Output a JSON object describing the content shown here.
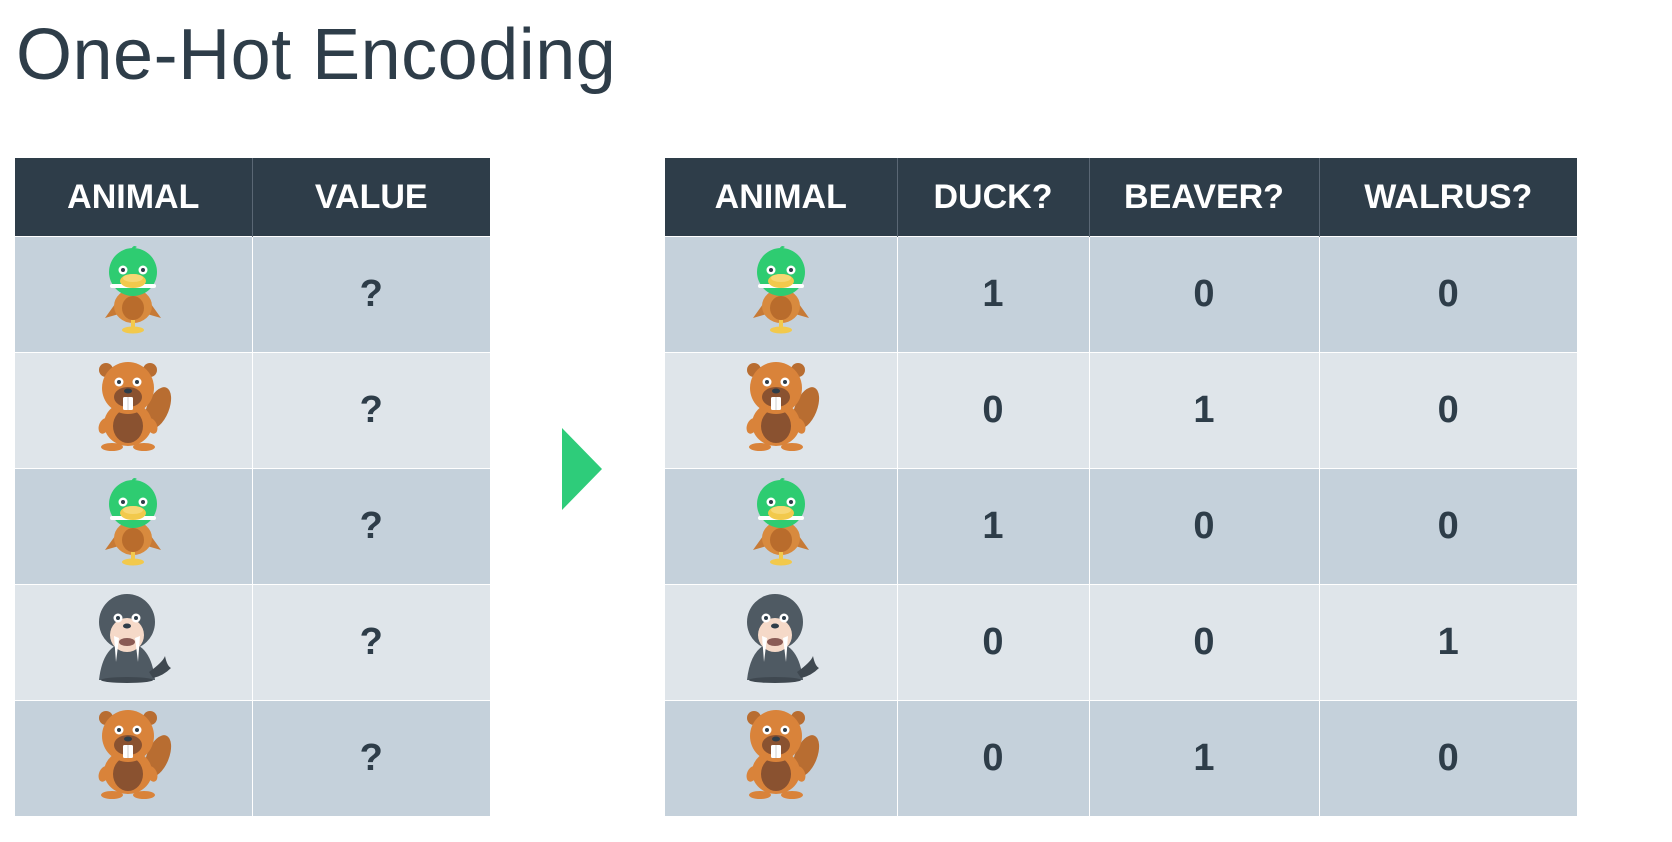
{
  "title": "One-Hot Encoding",
  "left_table": {
    "headers": [
      "ANIMAL",
      "VALUE"
    ],
    "rows": [
      {
        "animal": "duck",
        "value": "?"
      },
      {
        "animal": "beaver",
        "value": "?"
      },
      {
        "animal": "duck",
        "value": "?"
      },
      {
        "animal": "walrus",
        "value": "?"
      },
      {
        "animal": "beaver",
        "value": "?"
      }
    ]
  },
  "right_table": {
    "headers": [
      "ANIMAL",
      "DUCK?",
      "BEAVER?",
      "WALRUS?"
    ],
    "rows": [
      {
        "animal": "duck",
        "duck": "1",
        "beaver": "0",
        "walrus": "0"
      },
      {
        "animal": "beaver",
        "duck": "0",
        "beaver": "1",
        "walrus": "0"
      },
      {
        "animal": "duck",
        "duck": "1",
        "beaver": "0",
        "walrus": "0"
      },
      {
        "animal": "walrus",
        "duck": "0",
        "beaver": "0",
        "walrus": "1"
      },
      {
        "animal": "beaver",
        "duck": "0",
        "beaver": "1",
        "walrus": "0"
      }
    ]
  },
  "icons": {
    "arrow": "play-arrow-icon"
  },
  "colors": {
    "header_bg": "#2e3d49",
    "row_dark": "#c5d1db",
    "row_light": "#dfe5ea",
    "arrow": "#2ecc7a",
    "title": "#2e3d49"
  }
}
